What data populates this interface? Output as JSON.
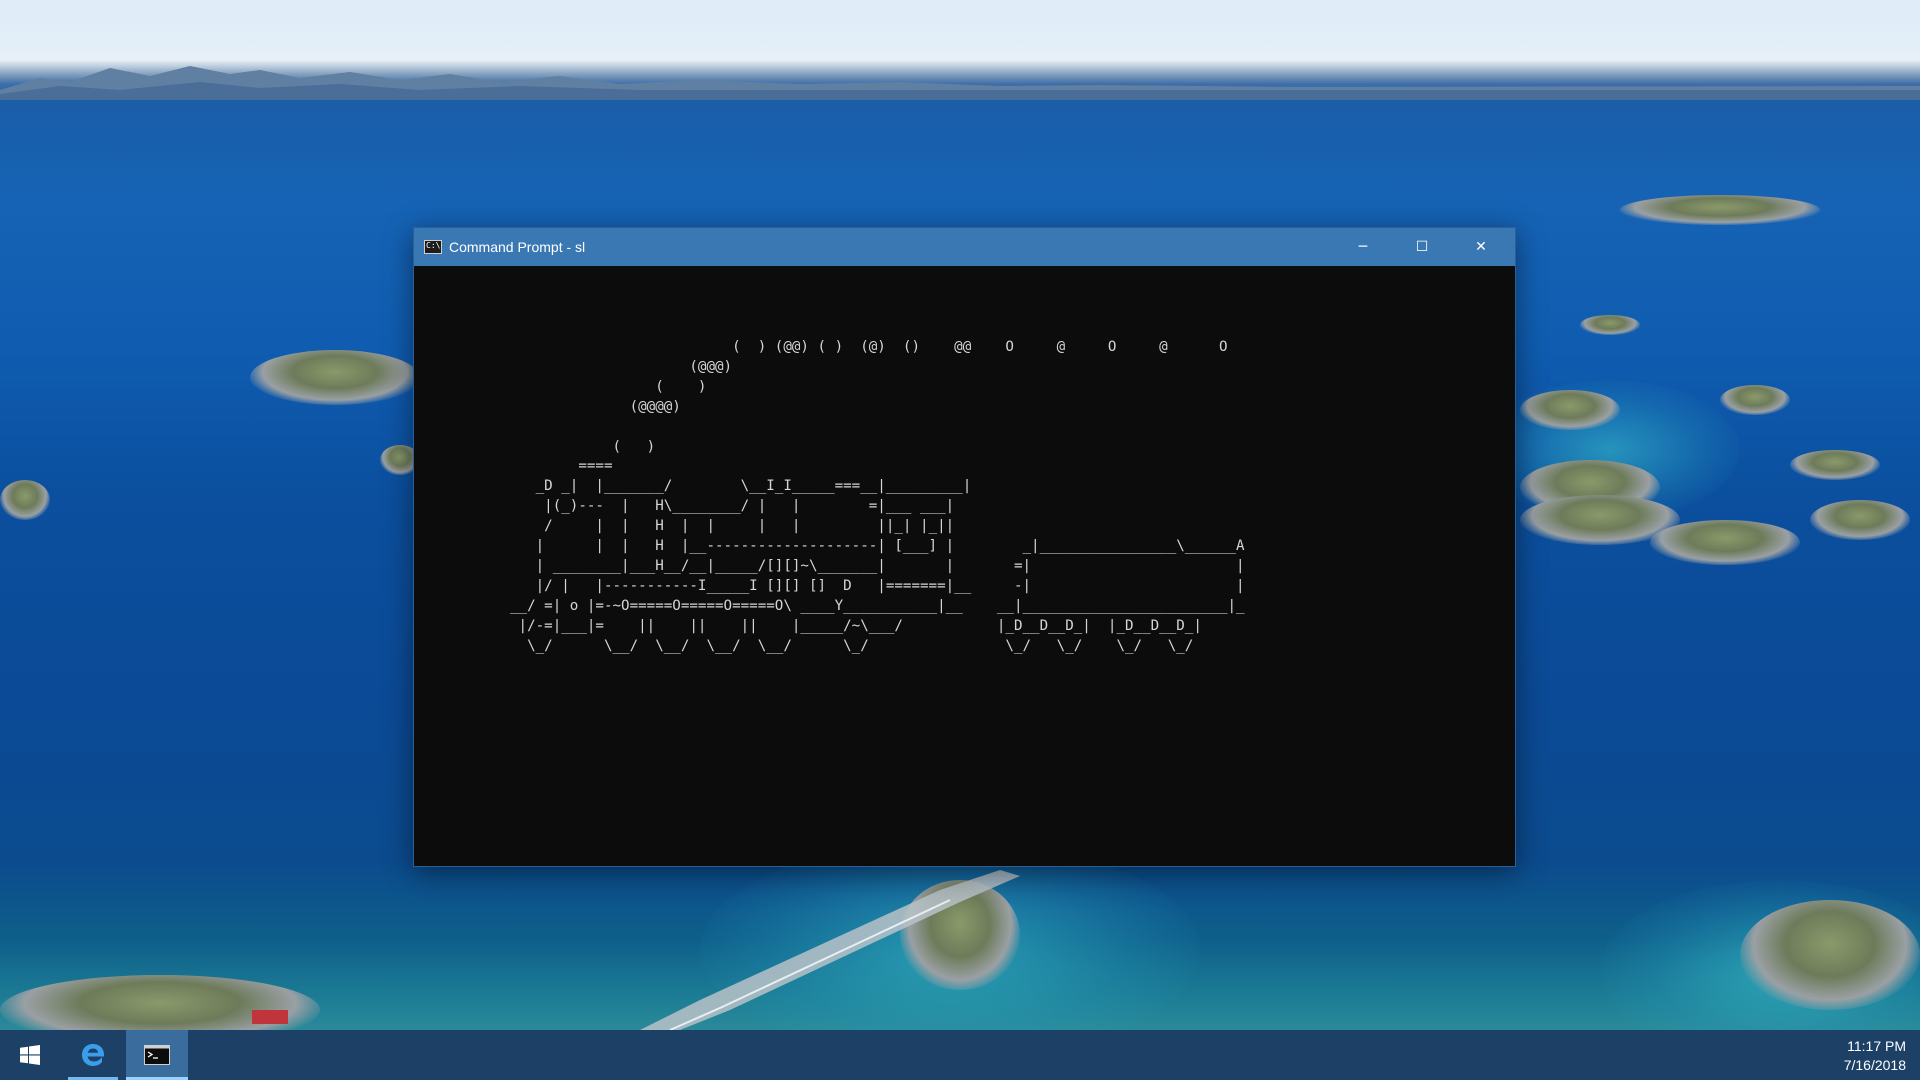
{
  "window": {
    "title": "Command Prompt - sl",
    "icon_text": "C:\\",
    "controls": {
      "minimize": "─",
      "maximize": "☐",
      "close": "✕"
    }
  },
  "console": {
    "lines": [
      "                          (  ) (@@) ( )  (@)  ()    @@    O     @     O     @      O",
      "                     (@@@)",
      "                 (    )",
      "              (@@@@)",
      "",
      "            (   )",
      "        ====",
      "   _D _|  |_______/        \\__I_I_____===__|_________|",
      "    |(_)---  |   H\\________/ |   |        =|___ ___|",
      "    /     |  |   H  |  |     |   |         ||_| |_||",
      "   |      |  |   H  |__--------------------| [___] |",
      "   | ________|___H__/__|_____/[][]~\\_______|       |",
      "   |/ |   |-----------I_____I [][] []  D   |=======|__",
      "__/ =| o |=-~O=====O=====O=====O\\ ____Y___________|__",
      " |/-=|___|=    ||    ||    ||    |_____/~\\___/",
      "  \\_/      \\__/  \\__/  \\__/  \\__/      \\_/"
    ],
    "tender_lines": [
      "",
      "",
      "",
      "",
      "",
      "",
      "",
      "",
      "",
      "",
      "   _|________________\\______A",
      "  =|                        |",
      "  -|                        |",
      "__|________________________|_",
      "|_D__D__D_|  |_D__D__D_|",
      " \\_/   \\_/    \\_/   \\_/"
    ]
  },
  "taskbar": {
    "apps": [
      {
        "name": "Start",
        "icon": "windows-logo-icon"
      },
      {
        "name": "Microsoft Edge",
        "icon": "edge-icon"
      },
      {
        "name": "Command Prompt",
        "icon": "cmd-icon"
      }
    ],
    "time": "11:17 PM",
    "date": "7/16/2018"
  }
}
